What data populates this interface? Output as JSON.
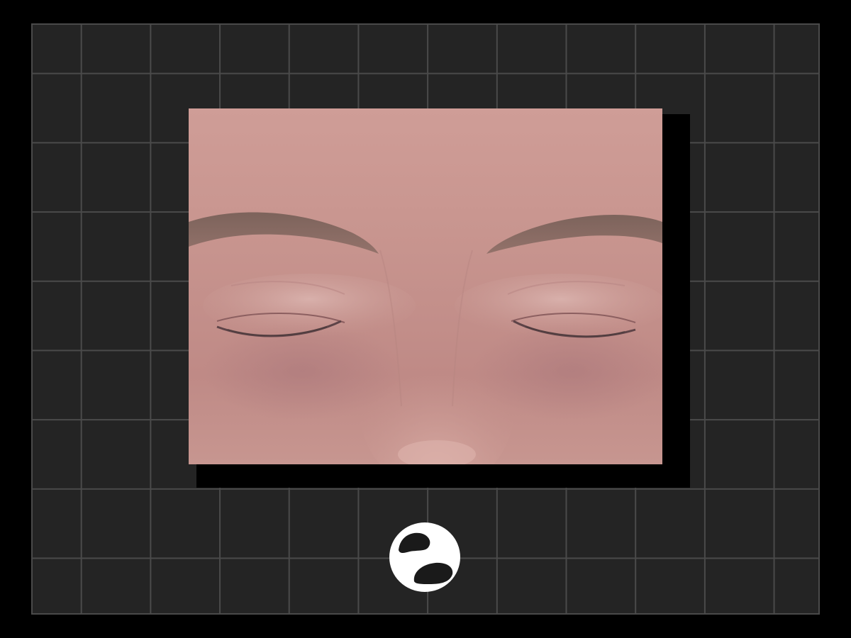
{
  "colors": {
    "background": "#000000",
    "grid_panel": "#242424",
    "grid_lines": "#4a4a4a",
    "skin": "#c89a94",
    "logo": "#ffffff"
  },
  "icons": {
    "logo": "circle-logo-icon"
  }
}
